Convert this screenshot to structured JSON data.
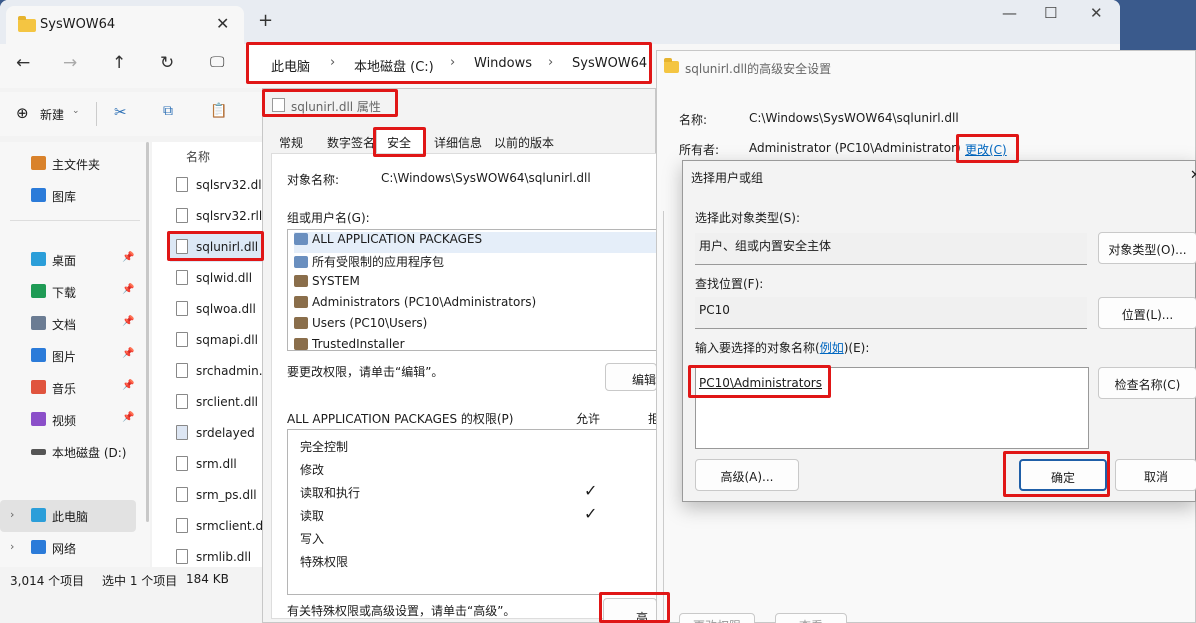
{
  "explorer": {
    "tab_title": "SysWOW64",
    "breadcrumbs": [
      "此电脑",
      "本地磁盘 (C:)",
      "Windows",
      "SysWOW64"
    ],
    "toolbar_new": "新建",
    "column_name": "名称",
    "sidebar": [
      {
        "label": "主文件夹",
        "color": "#d9822b",
        "pinned": false
      },
      {
        "label": "图库",
        "color": "#2b7bd9",
        "pinned": false
      },
      {
        "label": "桌面",
        "color": "#2b9ed9",
        "pinned": true
      },
      {
        "label": "下载",
        "color": "#1f9b55",
        "pinned": true
      },
      {
        "label": "文档",
        "color": "#6b7c93",
        "pinned": true
      },
      {
        "label": "图片",
        "color": "#2b7bd9",
        "pinned": true
      },
      {
        "label": "音乐",
        "color": "#e0543e",
        "pinned": true
      },
      {
        "label": "视频",
        "color": "#8b4fc9",
        "pinned": true
      },
      {
        "label": "本地磁盘 (D:)",
        "color": "#555555",
        "pinned": false
      },
      {
        "label": "此电脑",
        "color": "#2b9ed9",
        "pinned": false
      },
      {
        "label": "网络",
        "color": "#2b7bd9",
        "pinned": false
      }
    ],
    "files": [
      "sqlsrv32.dll",
      "sqlsrv32.rll",
      "sqlunirl.dll",
      "sqlwid.dll",
      "sqlwoa.dll",
      "sqmapi.dll",
      "srchadmin.d",
      "srclient.dll",
      "srdelayed",
      "srm.dll",
      "srm_ps.dll",
      "srmclient.dll",
      "srmlib.dll"
    ],
    "status": {
      "count": "3,014 个项目",
      "selected": "选中 1 个项目",
      "size": "184 KB"
    }
  },
  "props": {
    "title": "sqlunirl.dll 属性",
    "tabs": [
      "常规",
      "数字签名",
      "安全",
      "详细信息",
      "以前的版本"
    ],
    "object_label": "对象名称:",
    "object_value": "C:\\Windows\\SysWOW64\\sqlunirl.dll",
    "groups_label": "组或用户名(G):",
    "groups": [
      "ALL APPLICATION PACKAGES",
      "所有受限制的应用程序包",
      "SYSTEM",
      "Administrators (PC10\\Administrators)",
      "Users (PC10\\Users)",
      "TrustedInstaller"
    ],
    "edit_hint": "要更改权限，请单击“编辑”。",
    "edit_button": "编辑",
    "perm_title": "ALL APPLICATION PACKAGES 的权限(P)",
    "allow": "允许",
    "deny": "拒",
    "permissions": [
      "完全控制",
      "修改",
      "读取和执行",
      "读取",
      "写入",
      "特殊权限"
    ],
    "adv_hint": "有关特殊权限或高级设置，请单击“高级”。",
    "adv_button": "高级"
  },
  "adv": {
    "title": "sqlunirl.dll的高级安全设置",
    "name_label": "名称:",
    "name_value": "C:\\Windows\\SysWOW64\\sqlunirl.dll",
    "owner_label": "所有者:",
    "owner_value": "Administrator (PC10\\Administrator)",
    "change_link": "更改(C)",
    "bottom_left": "更改权限",
    "bottom_right": "查看"
  },
  "select": {
    "title": "选择用户或组",
    "type_label": "选择此对象类型(S):",
    "type_value": "用户、组或内置安全主体",
    "type_button": "对象类型(O)...",
    "loc_label": "查找位置(F):",
    "loc_value": "PC10",
    "loc_button": "位置(L)...",
    "input_label_a": "输入要选择的对象名称(",
    "input_label_link": "例如",
    "input_label_b": ")(E):",
    "input_value": "PC10\\Administrators",
    "check_button": "检查名称(C)",
    "advanced_button": "高级(A)...",
    "ok_button": "确定",
    "cancel_button": "取消"
  }
}
